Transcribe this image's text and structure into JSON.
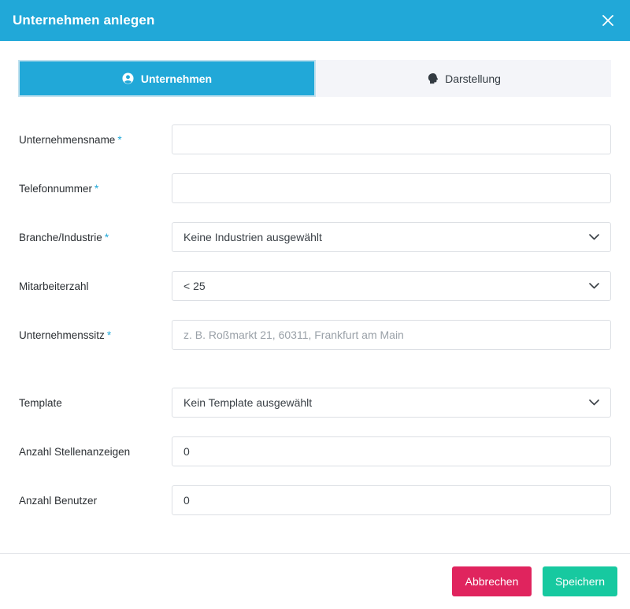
{
  "header": {
    "title": "Unternehmen anlegen"
  },
  "tabs": [
    {
      "label": "Unternehmen",
      "icon": "user-circle-icon",
      "active": true
    },
    {
      "label": "Darstellung",
      "icon": "head-icon",
      "active": false
    }
  ],
  "form": {
    "company_name": {
      "label": "Unternehmensname",
      "required_mark": "*",
      "value": ""
    },
    "phone": {
      "label": "Telefonnummer",
      "required_mark": "*",
      "value": ""
    },
    "industry": {
      "label": "Branche/Industrie",
      "required_mark": "*",
      "value": "Keine Industrien ausgewählt"
    },
    "employees": {
      "label": "Mitarbeiterzahl",
      "value": "< 25"
    },
    "headquarters": {
      "label": "Unternehmenssitz",
      "required_mark": "*",
      "value": "",
      "placeholder": "z. B. Roßmarkt 21, 60311, Frankfurt am Main"
    },
    "template": {
      "label": "Template",
      "value": "Kein Template ausgewählt"
    },
    "job_ads": {
      "label": "Anzahl Stellenanzeigen",
      "value": "0"
    },
    "users": {
      "label": "Anzahl Benutzer",
      "value": "0"
    }
  },
  "footer": {
    "cancel_label": "Abbrechen",
    "save_label": "Speichern"
  },
  "colors": {
    "primary": "#21a8d8",
    "danger": "#e0245e",
    "success": "#17c9a0"
  }
}
